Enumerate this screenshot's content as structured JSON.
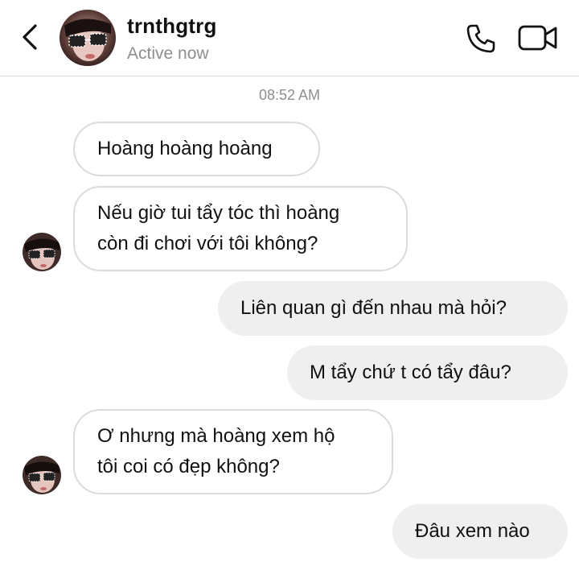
{
  "header": {
    "username": "trnthgtrg",
    "status": "Active now"
  },
  "conversation": {
    "timestamp": "08:52 AM",
    "messages": [
      {
        "sender": "them",
        "lines": [
          "Hoàng hoàng hoàng"
        ]
      },
      {
        "sender": "them",
        "lines": [
          "Nếu giờ tui tẩy tóc thì hoàng",
          "còn đi chơi với tôi không?"
        ]
      },
      {
        "sender": "me",
        "lines": [
          "Liên quan gì đến nhau mà hỏi?"
        ]
      },
      {
        "sender": "me",
        "lines": [
          "M tẩy chứ t có tẩy đâu?"
        ]
      },
      {
        "sender": "them",
        "lines": [
          "Ơ nhưng mà hoàng xem hộ",
          "tôi coi có đẹp không?"
        ]
      },
      {
        "sender": "me",
        "lines": [
          "Đâu xem nào"
        ]
      }
    ]
  },
  "colors": {
    "incoming_border": "#dbdbdb",
    "outgoing_bg": "#efefef",
    "muted_text": "#8e8e8e"
  }
}
